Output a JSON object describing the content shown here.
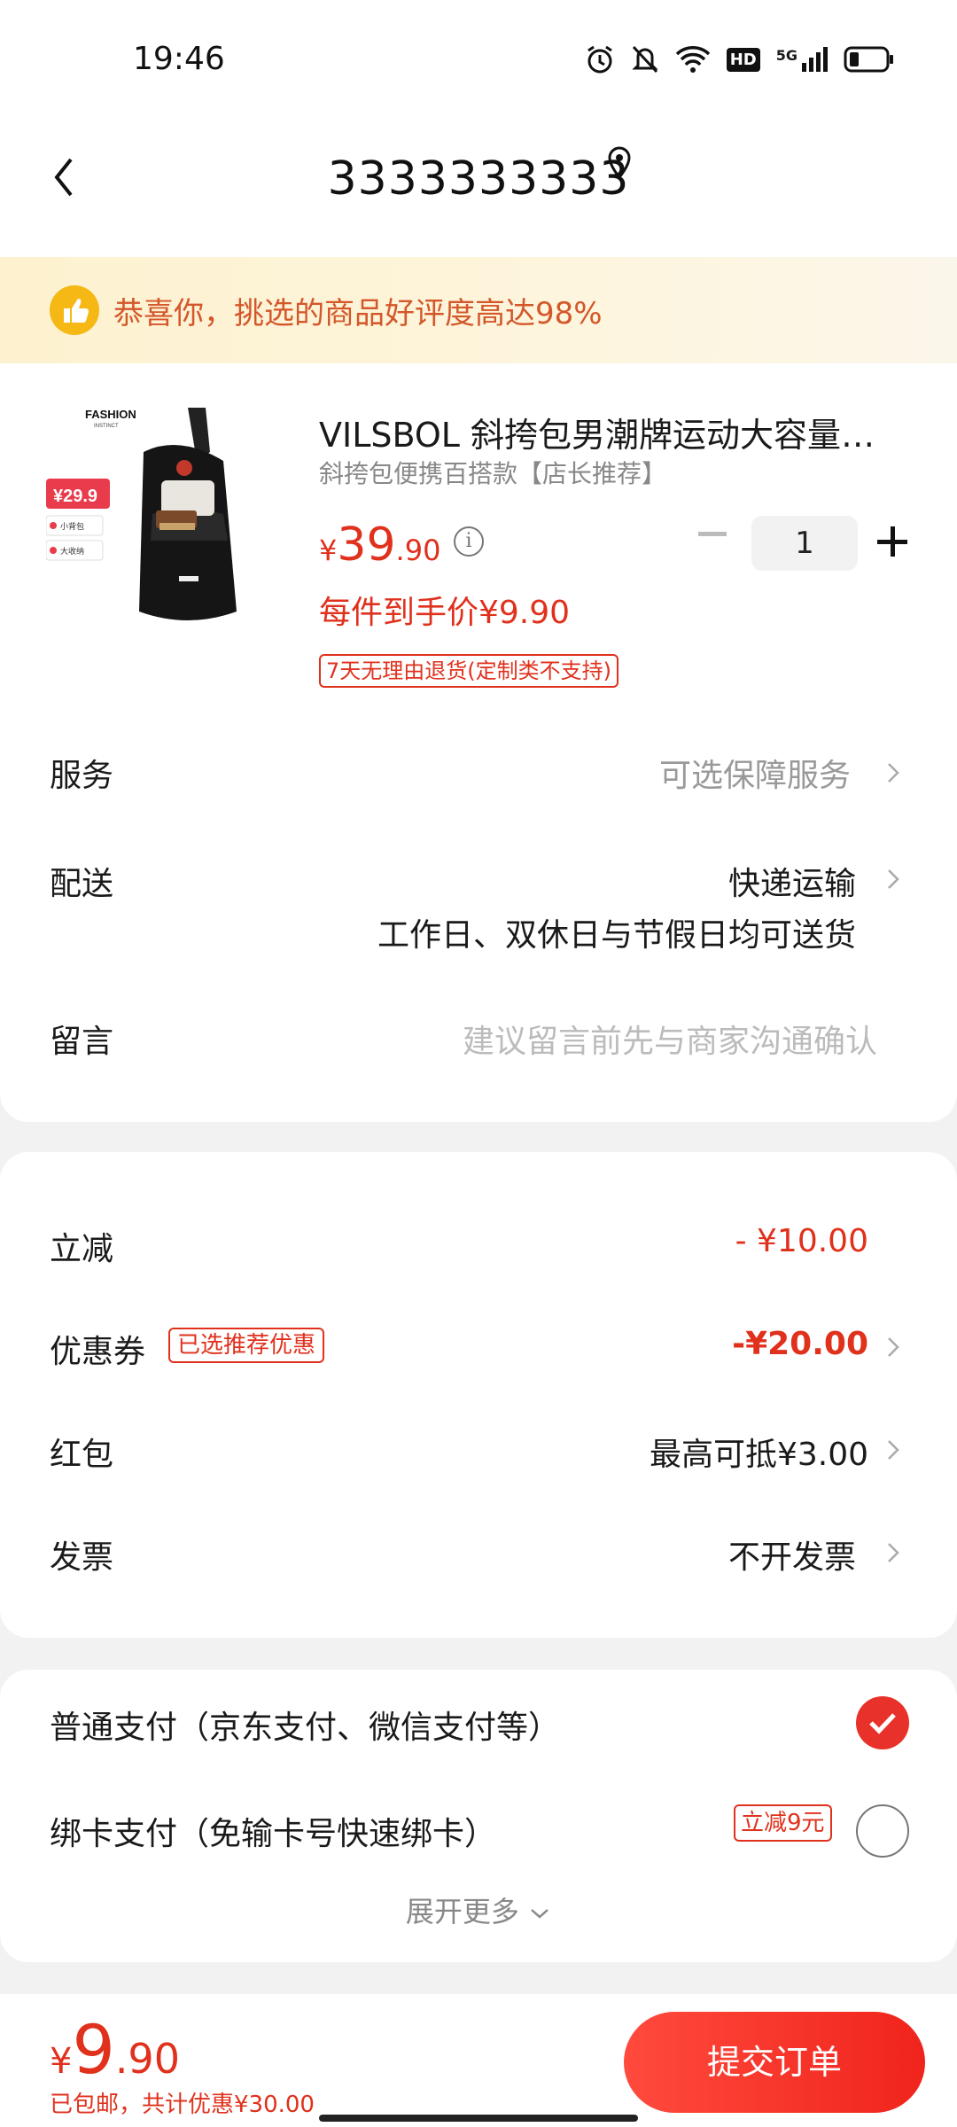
{
  "status_bar": {
    "time": "19:46",
    "network": "5G",
    "hd": "HD"
  },
  "header": {
    "title": "3333333333"
  },
  "banner": {
    "text": "恭喜你，挑选的商品好评度高达98%"
  },
  "product": {
    "image_text": "FASHION",
    "image_sub": "INSTINCT",
    "image_badge_price": "¥29.9",
    "image_badge_1": "小背包",
    "image_badge_2": "大收纳",
    "title": "VILSBOL 斜挎包男潮牌运动大容量挎…",
    "subtitle": "斜挎包便携百搭款【店长推荐】",
    "price_currency": "¥",
    "price_int": "39",
    "price_dec": ".90",
    "quantity": "1",
    "per_price": "每件到手价¥9.90",
    "return_tag": "7天无理由退货(定制类不支持)"
  },
  "rows": {
    "service": {
      "label": "服务",
      "value": "可选保障服务"
    },
    "delivery": {
      "label": "配送",
      "value": "快递运输",
      "note": "工作日、双休日与节假日均可送货"
    },
    "message": {
      "label": "留言",
      "placeholder": "建议留言前先与商家沟通确认"
    }
  },
  "discounts": {
    "instant": {
      "label": "立减",
      "value": "- ¥10.00"
    },
    "coupon": {
      "label": "优惠券",
      "tag": "已选推荐优惠",
      "value": "-¥20.00"
    },
    "redpacket": {
      "label": "红包",
      "value": "最高可抵¥3.00"
    },
    "invoice": {
      "label": "发票",
      "value": "不开发票"
    }
  },
  "payment": {
    "normal": {
      "label": "普通支付（京东支付、微信支付等）",
      "selected": true
    },
    "card": {
      "label": "绑卡支付（免输卡号快速绑卡）",
      "tag": "立减9元",
      "selected": false
    },
    "expand": "展开更多"
  },
  "bottom": {
    "currency": "¥",
    "total_int": "9",
    "total_dec": ".90",
    "note": "已包邮，共计优惠¥30.00",
    "submit": "提交订单"
  },
  "colors": {
    "accent": "#e0311d",
    "banner_text": "#d4572a",
    "banner_bg": "#fdf1cf"
  }
}
